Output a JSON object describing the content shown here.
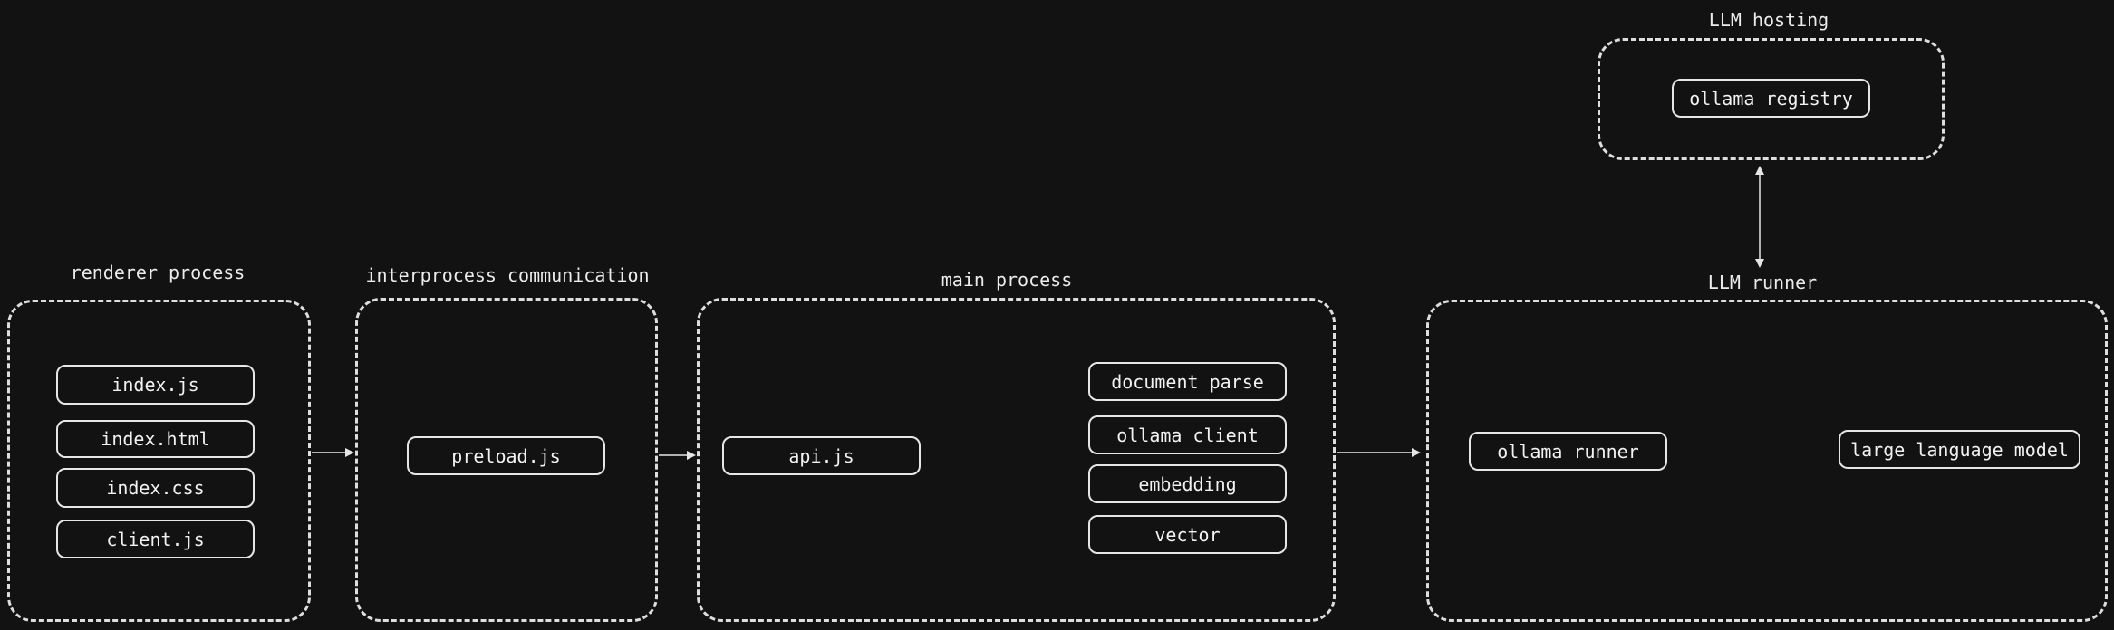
{
  "groups": {
    "renderer": {
      "label": "renderer process",
      "nodes": [
        "index.js",
        "index.html",
        "index.css",
        "client.js"
      ]
    },
    "ipc": {
      "label": "interprocess communication",
      "nodes": [
        "preload.js"
      ]
    },
    "main": {
      "label": "main process",
      "nodes": [
        "api.js",
        "document parse",
        "ollama client",
        "embedding",
        "vector"
      ]
    },
    "runner": {
      "label": "LLM runner",
      "nodes": [
        "ollama runner",
        "large language model"
      ]
    },
    "hosting": {
      "label": "LLM hosting",
      "nodes": [
        "ollama registry"
      ]
    }
  },
  "colors": {
    "background": "#121212",
    "stroke": "#e6e6e6",
    "text": "#f2f2f2"
  }
}
